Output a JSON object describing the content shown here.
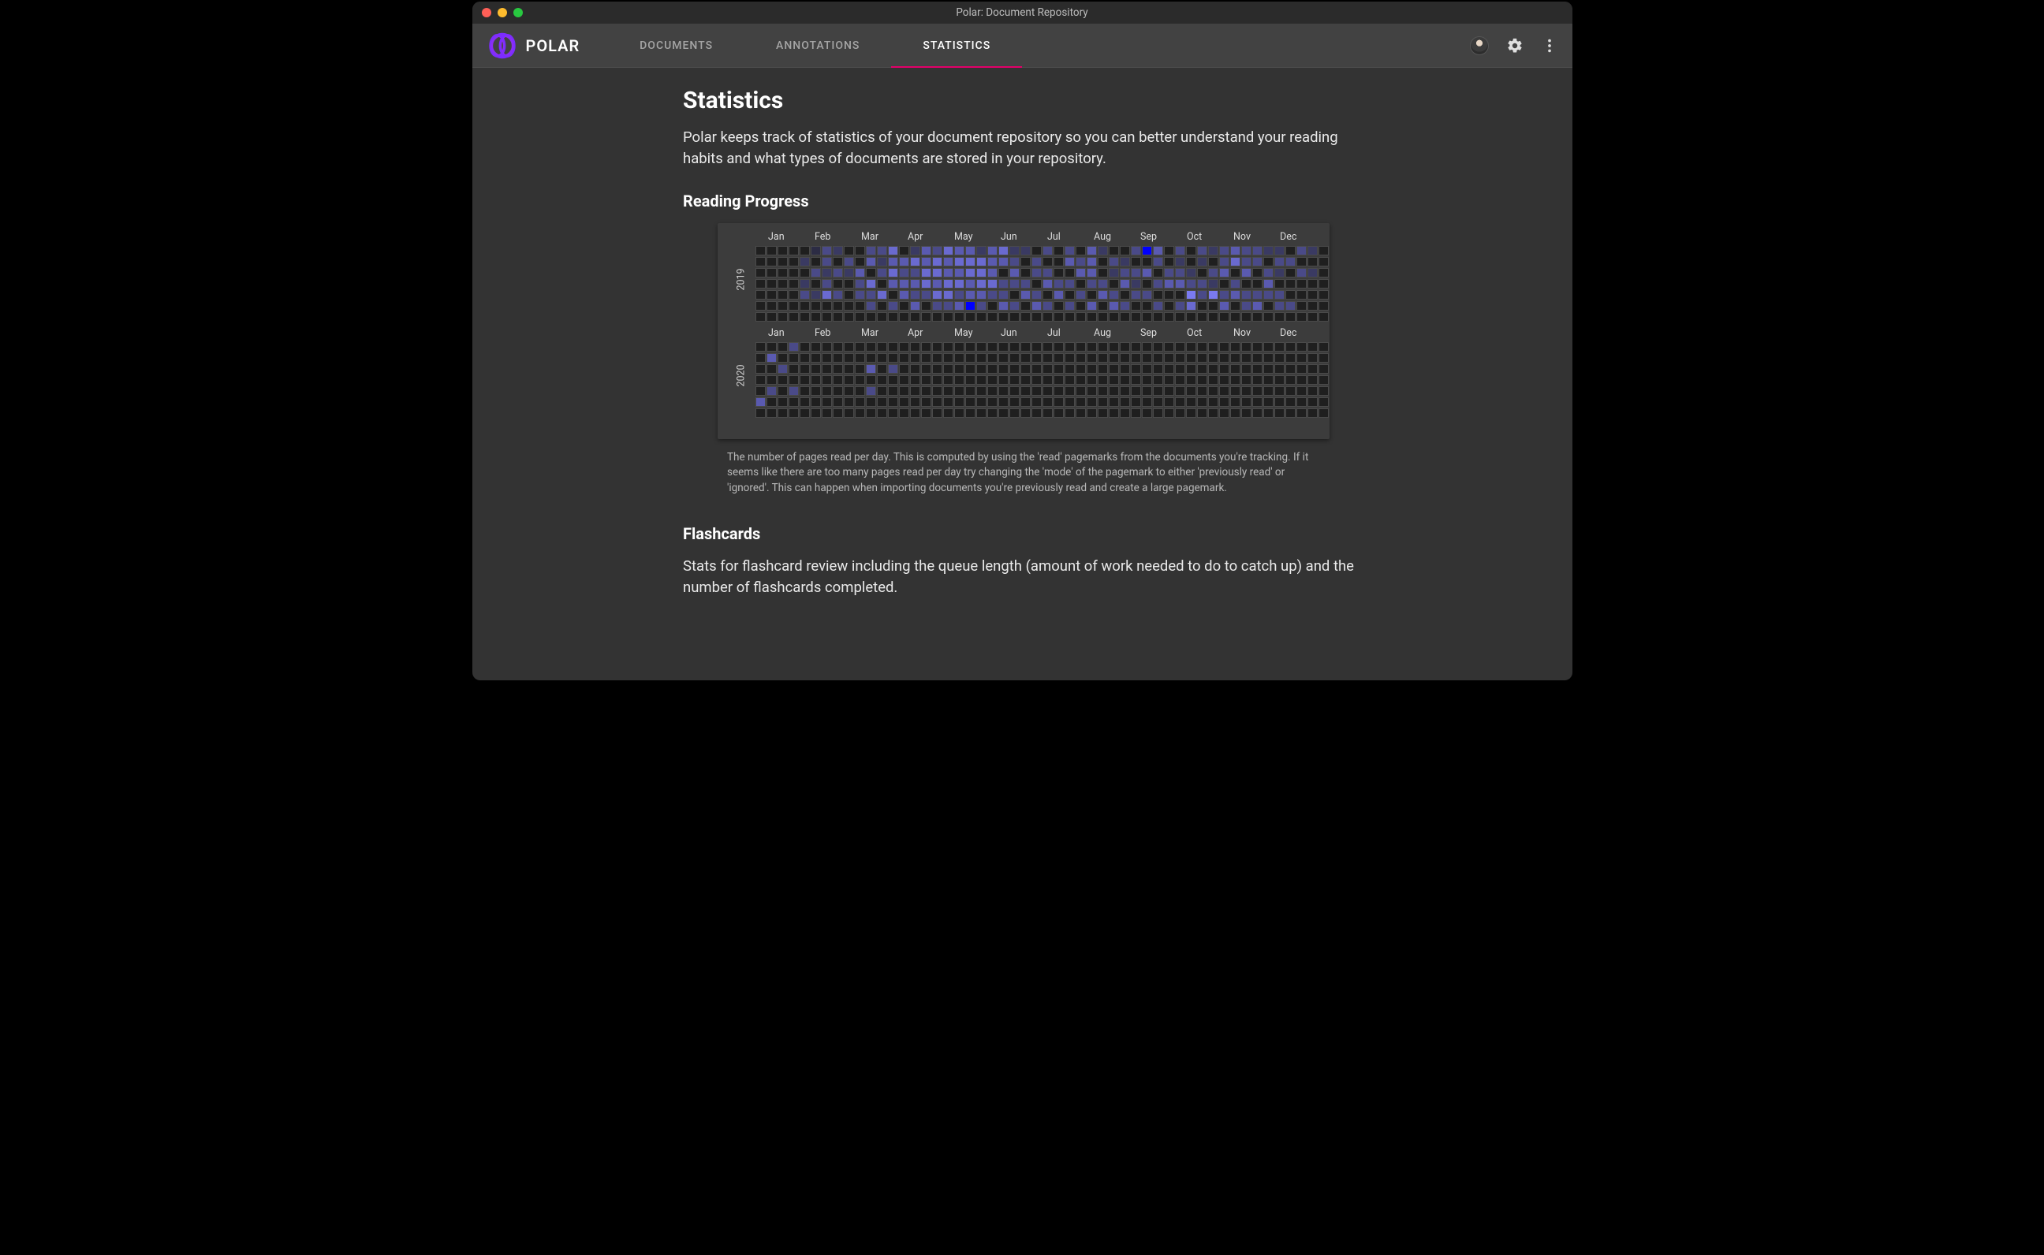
{
  "window": {
    "title": "Polar: Document Repository"
  },
  "brand": {
    "name": "POLAR"
  },
  "nav": {
    "tabs": [
      {
        "label": "DOCUMENTS",
        "active": false
      },
      {
        "label": "ANNOTATIONS",
        "active": false
      },
      {
        "label": "STATISTICS",
        "active": true
      }
    ]
  },
  "page": {
    "heading": "Statistics",
    "intro": "Polar keeps track of statistics of your document repository so you can better understand your reading habits and what types of documents are stored in your repository.",
    "reading_progress_heading": "Reading Progress",
    "reading_progress_caption": "The number of pages read per day. This is computed by using the 'read' pagemarks from the documents you're tracking. If it seems like there are too many pages read per day try changing the 'mode' of the pagemark to either 'previously read' or 'ignored'. This can happen when importing documents you're previously read and create a large pagemark.",
    "flashcards_heading": "Flashcards",
    "flashcards_intro": "Stats for flashcard review including the queue length (amount of work needed to do to catch up) and the number of flashcards completed."
  },
  "chart_data": [
    {
      "type": "heatmap",
      "year": "2019",
      "months": [
        "Jan",
        "Feb",
        "Mar",
        "Apr",
        "May",
        "Jun",
        "Jul",
        "Aug",
        "Sep",
        "Oct",
        "Nov",
        "Dec"
      ],
      "rows": 7,
      "cols": 52,
      "scale": {
        "min": 0,
        "max": 9,
        "colors": [
          "#1f1f1f",
          "#2c2c44",
          "#3a3a62",
          "#4a4a88",
          "#5a5ab0",
          "#6a6ad0",
          "#7a7af0",
          "#4040ff",
          "#1e1eff",
          "#0000ff"
        ]
      },
      "values_note": "intensity 0..9 per week(col)×day(row), estimated from pixel brightness",
      "data": [
        [
          0,
          0,
          0,
          0,
          0,
          1,
          3,
          2,
          0,
          0,
          3,
          3,
          5,
          0,
          2,
          4,
          3,
          5,
          4,
          4,
          2,
          4,
          5,
          2,
          2,
          0,
          3,
          0,
          3,
          0,
          4,
          2,
          0,
          0,
          3,
          9,
          4,
          0,
          3,
          0,
          3,
          2,
          3,
          4,
          3,
          3,
          2,
          2,
          0,
          3,
          2,
          0
        ],
        [
          0,
          0,
          0,
          0,
          2,
          0,
          3,
          0,
          3,
          0,
          4,
          2,
          4,
          4,
          5,
          4,
          5,
          4,
          5,
          5,
          5,
          4,
          4,
          3,
          0,
          3,
          0,
          0,
          4,
          3,
          4,
          0,
          3,
          2,
          0,
          0,
          3,
          0,
          2,
          0,
          2,
          0,
          3,
          5,
          3,
          3,
          0,
          3,
          3,
          0,
          0,
          0
        ],
        [
          0,
          0,
          0,
          0,
          0,
          3,
          2,
          3,
          2,
          4,
          0,
          3,
          5,
          3,
          3,
          5,
          5,
          4,
          4,
          5,
          5,
          4,
          0,
          4,
          0,
          3,
          3,
          0,
          0,
          4,
          4,
          0,
          2,
          3,
          3,
          4,
          0,
          3,
          3,
          2,
          0,
          3,
          4,
          0,
          4,
          0,
          3,
          2,
          0,
          3,
          2,
          0
        ],
        [
          0,
          0,
          0,
          0,
          2,
          0,
          3,
          0,
          0,
          3,
          5,
          0,
          4,
          4,
          4,
          5,
          4,
          5,
          5,
          4,
          5,
          5,
          3,
          3,
          3,
          0,
          4,
          3,
          3,
          0,
          3,
          3,
          0,
          4,
          2,
          0,
          3,
          4,
          4,
          3,
          3,
          2,
          0,
          3,
          0,
          0,
          4,
          0,
          0,
          0,
          0,
          0
        ],
        [
          0,
          0,
          0,
          0,
          3,
          2,
          5,
          3,
          0,
          3,
          3,
          5,
          0,
          4,
          3,
          3,
          5,
          5,
          3,
          4,
          4,
          3,
          3,
          0,
          4,
          3,
          0,
          4,
          0,
          3,
          0,
          4,
          3,
          0,
          3,
          3,
          0,
          0,
          0,
          6,
          3,
          6,
          3,
          4,
          3,
          3,
          3,
          3,
          0,
          0,
          0,
          0
        ],
        [
          0,
          0,
          0,
          0,
          0,
          0,
          0,
          0,
          0,
          0,
          3,
          0,
          3,
          0,
          4,
          0,
          3,
          3,
          4,
          9,
          3,
          0,
          4,
          3,
          0,
          4,
          3,
          0,
          3,
          0,
          4,
          0,
          4,
          3,
          0,
          0,
          3,
          0,
          3,
          5,
          0,
          0,
          4,
          0,
          3,
          4,
          0,
          3,
          3,
          0,
          0,
          0
        ],
        [
          0,
          0,
          0,
          0,
          0,
          0,
          0,
          0,
          0,
          0,
          0,
          0,
          0,
          0,
          0,
          0,
          0,
          0,
          0,
          0,
          0,
          0,
          0,
          0,
          0,
          0,
          0,
          0,
          0,
          0,
          0,
          0,
          0,
          0,
          0,
          0,
          0,
          0,
          0,
          0,
          0,
          0,
          0,
          0,
          0,
          0,
          0,
          0,
          0,
          0,
          0,
          0
        ]
      ]
    },
    {
      "type": "heatmap",
      "year": "2020",
      "months": [
        "Jan",
        "Feb",
        "Mar",
        "Apr",
        "May",
        "Jun",
        "Jul",
        "Aug",
        "Sep",
        "Oct",
        "Nov",
        "Dec"
      ],
      "rows": 7,
      "cols": 52,
      "scale": {
        "min": 0,
        "max": 9,
        "colors": [
          "#1f1f1f",
          "#2c2c44",
          "#3a3a62",
          "#4a4a88",
          "#5a5ab0",
          "#6a6ad0",
          "#7a7af0",
          "#4040ff",
          "#1e1eff",
          "#0000ff"
        ]
      },
      "values_note": "intensity 0..9 per week(col)×day(row), estimated from pixel brightness",
      "data": [
        [
          0,
          0,
          0,
          3,
          0,
          0,
          0,
          0,
          0,
          0,
          0,
          0,
          0,
          0,
          0,
          0,
          0,
          0,
          0,
          0,
          0,
          0,
          0,
          0,
          0,
          0,
          0,
          0,
          0,
          0,
          0,
          0,
          0,
          0,
          0,
          0,
          0,
          0,
          0,
          0,
          0,
          0,
          0,
          0,
          0,
          0,
          0,
          0,
          0,
          0,
          0,
          0
        ],
        [
          0,
          4,
          0,
          0,
          0,
          0,
          0,
          0,
          0,
          0,
          0,
          0,
          0,
          0,
          0,
          0,
          0,
          0,
          0,
          0,
          0,
          0,
          0,
          0,
          0,
          0,
          0,
          0,
          0,
          0,
          0,
          0,
          0,
          0,
          0,
          0,
          0,
          0,
          0,
          0,
          0,
          0,
          0,
          0,
          0,
          0,
          0,
          0,
          0,
          0,
          0,
          0
        ],
        [
          0,
          0,
          3,
          0,
          0,
          0,
          0,
          0,
          0,
          0,
          4,
          0,
          3,
          0,
          0,
          0,
          0,
          0,
          0,
          0,
          0,
          0,
          0,
          0,
          0,
          0,
          0,
          0,
          0,
          0,
          0,
          0,
          0,
          0,
          0,
          0,
          0,
          0,
          0,
          0,
          0,
          0,
          0,
          0,
          0,
          0,
          0,
          0,
          0,
          0,
          0,
          0
        ],
        [
          0,
          0,
          0,
          0,
          0,
          0,
          0,
          0,
          0,
          0,
          0,
          0,
          0,
          0,
          0,
          0,
          0,
          0,
          0,
          0,
          0,
          0,
          0,
          0,
          0,
          0,
          0,
          0,
          0,
          0,
          0,
          0,
          0,
          0,
          0,
          0,
          0,
          0,
          0,
          0,
          0,
          0,
          0,
          0,
          0,
          0,
          0,
          0,
          0,
          0,
          0,
          0
        ],
        [
          0,
          3,
          0,
          3,
          0,
          0,
          0,
          0,
          0,
          0,
          3,
          0,
          0,
          0,
          0,
          0,
          0,
          0,
          0,
          0,
          0,
          0,
          0,
          0,
          0,
          0,
          0,
          0,
          0,
          0,
          0,
          0,
          0,
          0,
          0,
          0,
          0,
          0,
          0,
          0,
          0,
          0,
          0,
          0,
          0,
          0,
          0,
          0,
          0,
          0,
          0,
          0
        ],
        [
          4,
          0,
          0,
          0,
          0,
          0,
          0,
          0,
          0,
          0,
          0,
          0,
          0,
          0,
          0,
          0,
          0,
          0,
          0,
          0,
          0,
          0,
          0,
          0,
          0,
          0,
          0,
          0,
          0,
          0,
          0,
          0,
          0,
          0,
          0,
          0,
          0,
          0,
          0,
          0,
          0,
          0,
          0,
          0,
          0,
          0,
          0,
          0,
          0,
          0,
          0,
          0
        ],
        [
          0,
          0,
          0,
          0,
          0,
          0,
          0,
          0,
          0,
          0,
          0,
          0,
          0,
          0,
          0,
          0,
          0,
          0,
          0,
          0,
          0,
          0,
          0,
          0,
          0,
          0,
          0,
          0,
          0,
          0,
          0,
          0,
          0,
          0,
          0,
          0,
          0,
          0,
          0,
          0,
          0,
          0,
          0,
          0,
          0,
          0,
          0,
          0,
          0,
          0,
          0,
          0
        ]
      ]
    }
  ]
}
